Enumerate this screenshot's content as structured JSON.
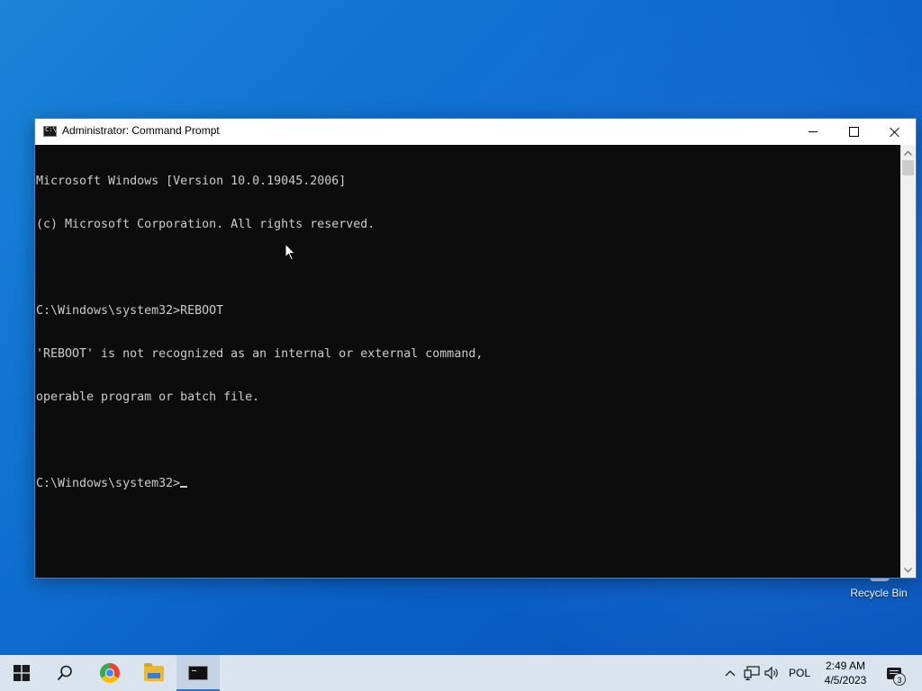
{
  "desktop": {
    "icons": [
      {
        "label": "Recycle Bin",
        "icon": "recycle-bin-icon"
      }
    ]
  },
  "window": {
    "title": "Administrator: Command Prompt",
    "icon": "cmd-icon",
    "controls": {
      "minimize": "minimize-icon",
      "maximize": "maximize-icon",
      "close": "close-icon"
    }
  },
  "console": {
    "lines": [
      "Microsoft Windows [Version 10.0.19045.2006]",
      "(c) Microsoft Corporation. All rights reserved.",
      "",
      "C:\\Windows\\system32>REBOOT",
      "'REBOOT' is not recognized as an internal or external command,",
      "operable program or batch file.",
      ""
    ],
    "prompt": "C:\\Windows\\system32>",
    "text_color": "#cccccc",
    "background": "#0c0c0c"
  },
  "taskbar": {
    "items": [
      {
        "name": "start",
        "icon": "windows-logo-icon"
      },
      {
        "name": "search",
        "icon": "search-icon"
      },
      {
        "name": "chrome",
        "icon": "chrome-icon"
      },
      {
        "name": "file-explorer",
        "icon": "folder-icon"
      },
      {
        "name": "command-prompt",
        "icon": "cmd-icon",
        "active": true
      }
    ],
    "tray": {
      "language": "POL",
      "time": "2:49 AM",
      "date": "4/5/2023",
      "notification_count": "3"
    },
    "accent": "#2b78d4"
  }
}
